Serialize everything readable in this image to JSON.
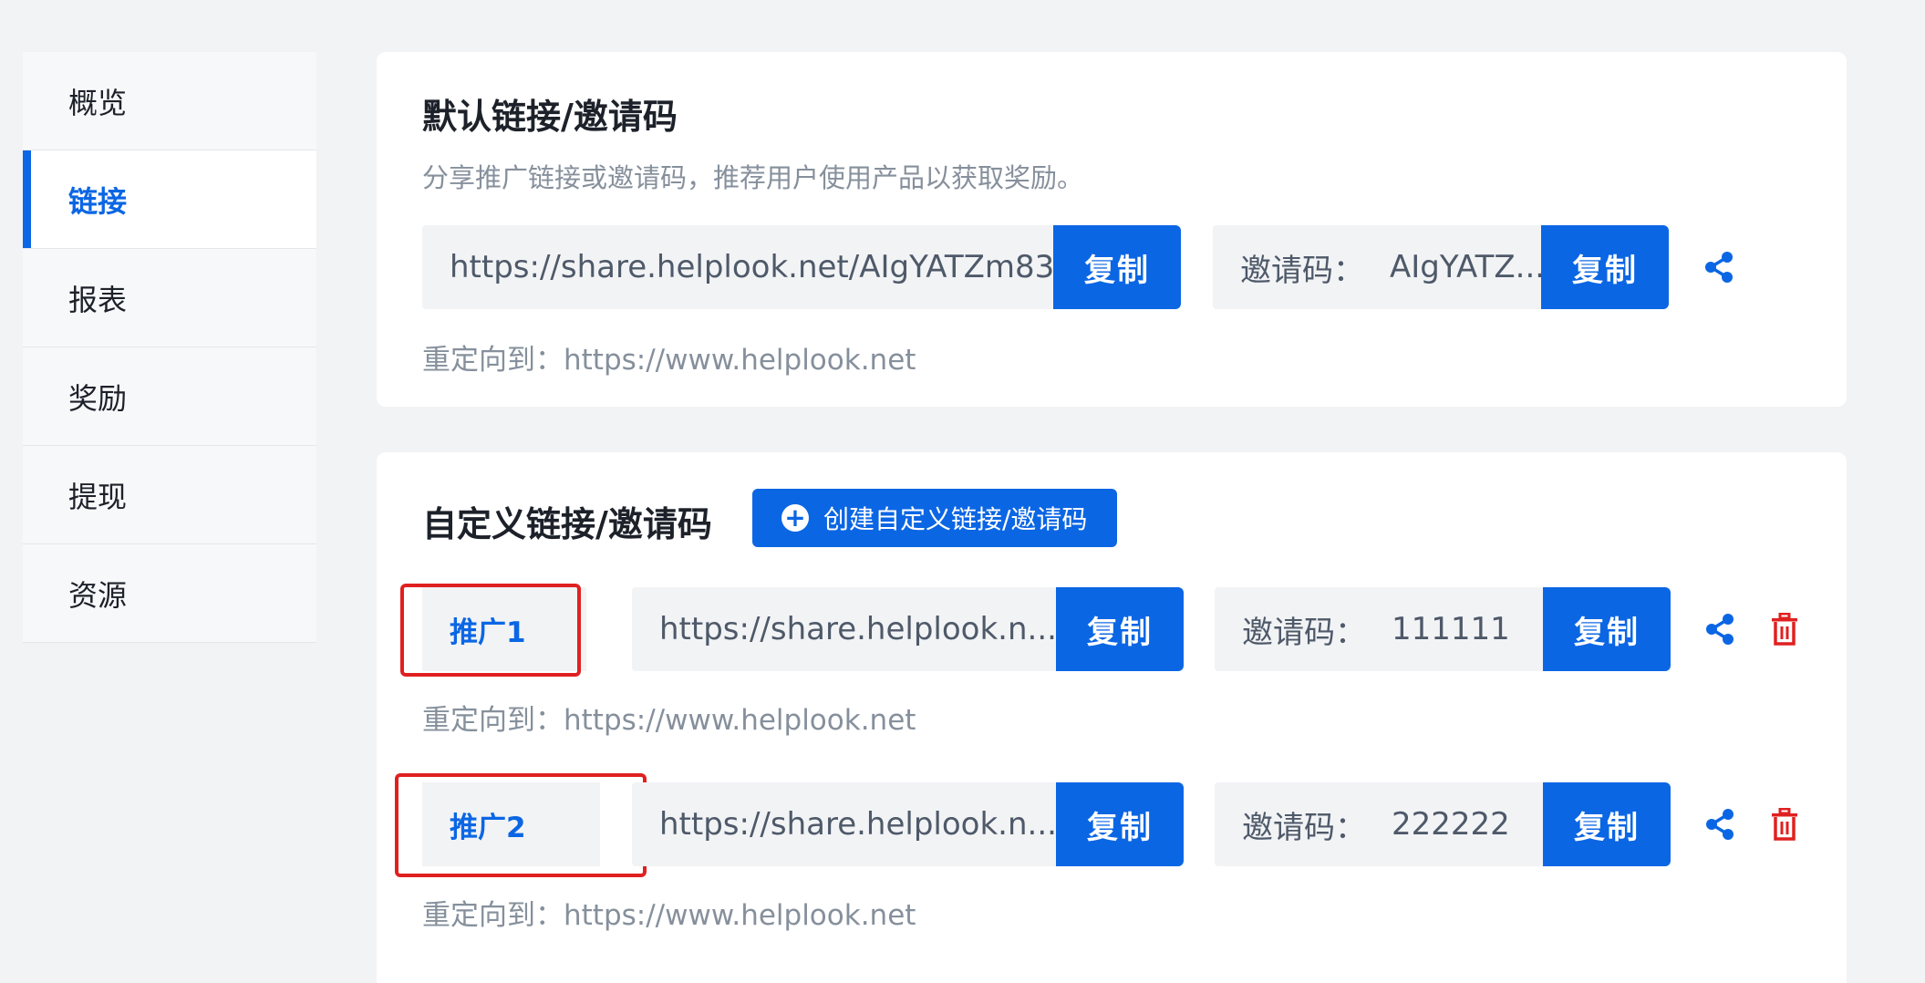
{
  "sidebar": {
    "items": [
      {
        "label": "概览"
      },
      {
        "label": "链接"
      },
      {
        "label": "报表"
      },
      {
        "label": "奖励"
      },
      {
        "label": "提现"
      },
      {
        "label": "资源"
      }
    ],
    "active_index": 1
  },
  "default_section": {
    "title": "默认链接/邀请码",
    "description": "分享推广链接或邀请码，推荐用户使用产品以获取奖励。",
    "link_value": "https://share.helplook.net/AIgYATZm83...",
    "copy_label": "复制",
    "invite_label": "邀请码：",
    "invite_value": "AIgYATZ...",
    "redirect_label": "重定向到：",
    "redirect_url": "https://www.helplook.net"
  },
  "custom_section": {
    "title": "自定义链接/邀请码",
    "create_button_label": "创建自定义链接/邀请码",
    "items": [
      {
        "name": "推广1",
        "link_value": "https://share.helplook.n...",
        "copy_label": "复制",
        "invite_label": "邀请码：",
        "invite_value": "111111",
        "redirect_label": "重定向到：",
        "redirect_url": "https://www.helplook.net"
      },
      {
        "name": "推广2",
        "link_value": "https://share.helplook.n...",
        "copy_label": "复制",
        "invite_label": "邀请码：",
        "invite_value": "222222",
        "redirect_label": "重定向到：",
        "redirect_url": "https://www.helplook.net"
      }
    ]
  },
  "colors": {
    "accent": "#0b66e4",
    "danger": "#e02020",
    "background": "#f2f3f5"
  },
  "icons": [
    "share-icon",
    "delete-icon",
    "plus-circle-icon"
  ]
}
